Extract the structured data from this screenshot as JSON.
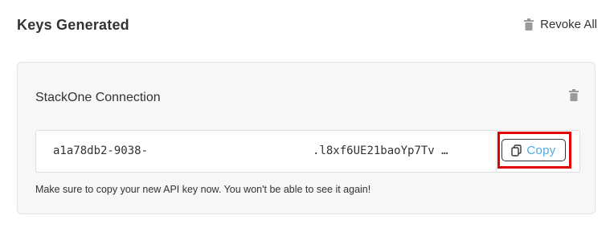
{
  "header": {
    "title": "Keys Generated",
    "revoke_all_label": "Revoke All",
    "revoke_icon": "trash-icon"
  },
  "connection": {
    "name": "StackOne Connection",
    "delete_icon": "trash-icon",
    "key_prefix": "a1a78db2-9038-",
    "key_suffix": ".l8xf6UE21baoYp7Tv …",
    "copy_label": "Copy",
    "copy_icon": "copy-icon",
    "hint": "Make sure to copy your new API key now. You won't be able to see it again!"
  },
  "colors": {
    "accent": "#4fa9e6",
    "highlight": "#e00000",
    "card_bg": "#f7f7f7"
  }
}
